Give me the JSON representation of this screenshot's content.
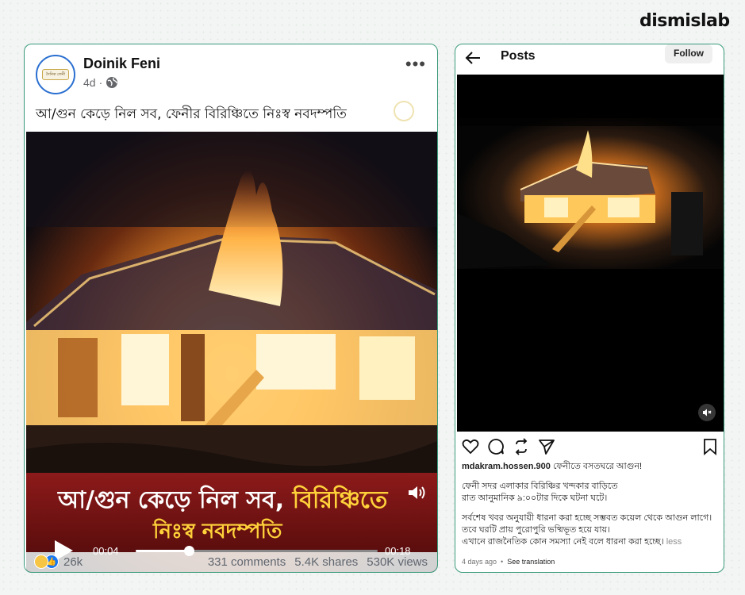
{
  "brand": {
    "name": "dismislab"
  },
  "facebook_post": {
    "page_name": "Doinik Feni",
    "avatar_text": "দৈনিক ফেনী",
    "age": "4d",
    "separator": "·",
    "more_glyph": "•••",
    "caption": "আ/গুন কেড়ে নিল সব, ফেনীর বিরিঞ্চিতে নিঃস্ব নবদম্পতি",
    "video": {
      "banner_line1_a": "আ/গুন কেড়ে নিল সব, ",
      "banner_line1_b": "বিরিঞ্চিতে",
      "banner_line2": "নিঃস্ব নবদম্পতি",
      "current_time": "00:04",
      "total_time": "00:18",
      "progress": 0.22
    },
    "reactions_count": "26k",
    "comments": "331 comments",
    "shares": "5.4K shares",
    "views": "530K views"
  },
  "instagram_post": {
    "header_title": "Posts",
    "follow_label": "Follow",
    "username": "mdakram.hossen.900",
    "headline": " ফেনীতে বসতঘরে আগুন!",
    "lines_a": [
      "ফেনী সদর এলাকার বিরিঞ্চির খন্দকার বাড়িতে",
      "রাত আনুমানিক ৯:০০টার দিকে ঘটনা ঘটে।"
    ],
    "lines_b": [
      "সর্বশেষ খবর অনুযায়ী ধারনা করা হচ্ছে সম্ভবত কয়েল থেকে আগুন লাগে।",
      "তবে ঘরটি প্রায় পুরোপুরি ভষ্মিভূত হয়ে যায়।",
      "এখানে রাজনৈতিক কোন সমস্যা নেই বলে ধারনা করা হচ্ছে।"
    ],
    "more_label": "less",
    "time_ago": "4 days ago",
    "dot": "•",
    "translate_label": "See translation"
  }
}
